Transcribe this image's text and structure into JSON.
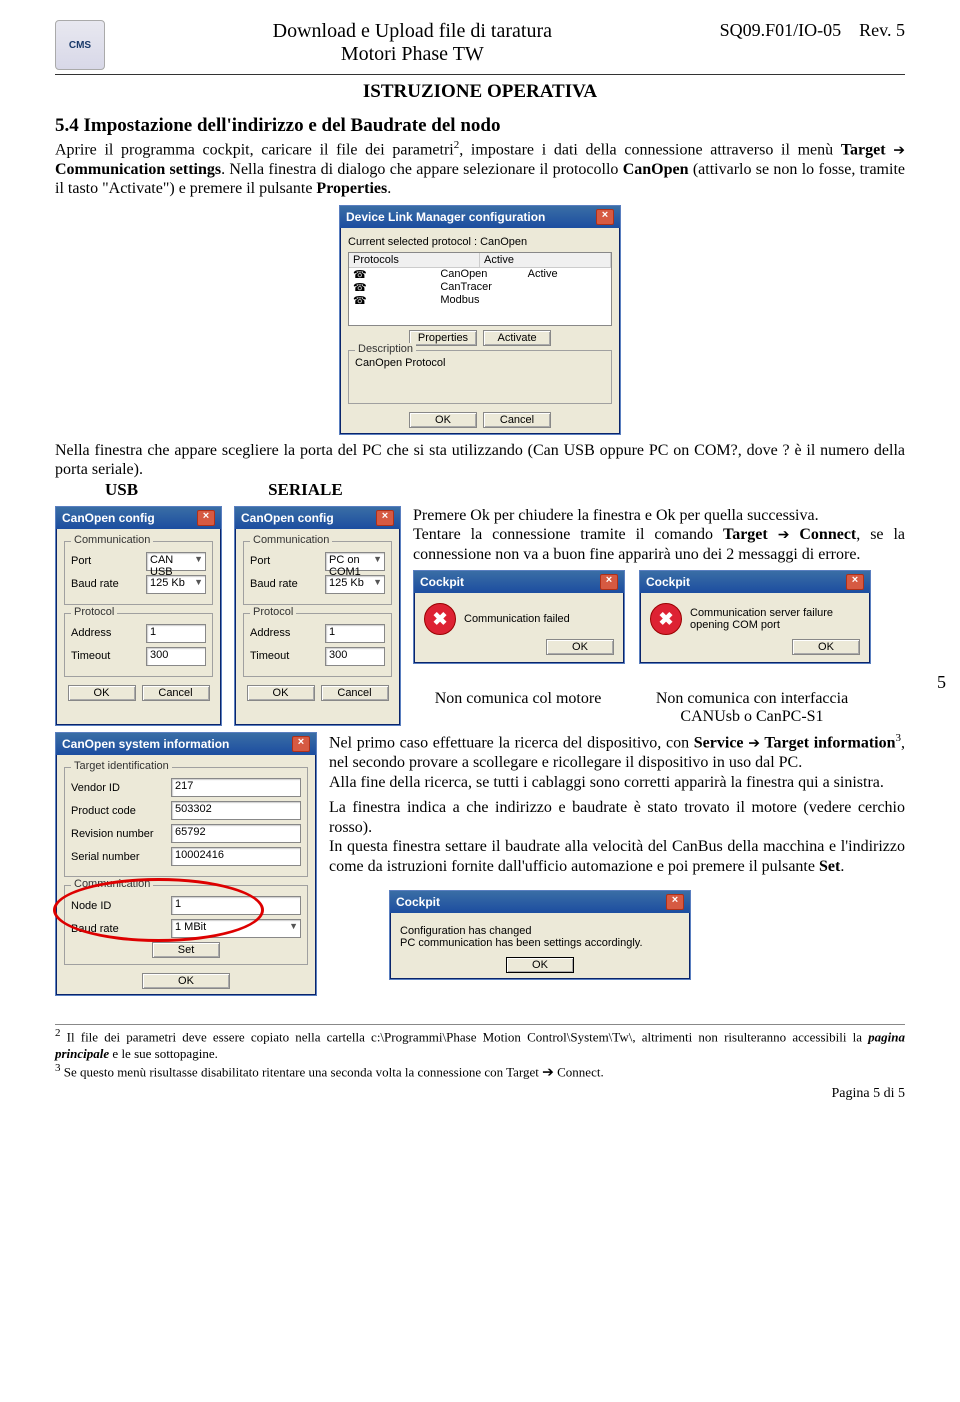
{
  "header": {
    "logo": "CMS",
    "title1": "Download e Upload file di taratura",
    "title2": "Motori Phase TW",
    "code": "SQ09.F01/IO-05",
    "rev": "Rev. 5"
  },
  "doc_title": "ISTRUZIONE OPERATIVA",
  "section_title": "5.4 Impostazione dell'indirizzo e del Baudrate del nodo",
  "para1a": "Aprire il programma cockpit, caricare il file dei parametri",
  "sup2": "2",
  "para1b": ", impostare i dati della connessione attraverso il menù ",
  "para1c": "Target ",
  "para1d": " Communication settings",
  "para1e": ". Nella finestra di dialogo che appare selezionare il protocollo ",
  "para1f": "CanOpen",
  "para1g": " (attivarlo se non lo fosse, tramite il tasto \"Activate\") e premere il pulsante ",
  "para1h": "Properties",
  "para1i": ".",
  "devlink": {
    "title": "Device Link Manager configuration",
    "cur": "Current selected protocol : CanOpen",
    "hdr1": "Protocols",
    "hdr2": "Active",
    "r1": "CanOpen",
    "r1a": "Active",
    "r2": "CanTracer",
    "r3": "Modbus",
    "props": "Properties",
    "activate": "Activate",
    "desc_lbl": "Description",
    "desc": "CanOpen Protocol",
    "ok": "OK",
    "cancel": "Cancel"
  },
  "side_num": "5",
  "para2": "Nella finestra che appare scegliere la porta del PC che si sta utilizzando (Can USB oppure PC on COM?, dove ? è il numero della porta seriale).",
  "colcap1": "USB",
  "colcap2": "SERIALE",
  "canopen": {
    "title": "CanOpen config",
    "comm": "Communication",
    "port": "Port",
    "baud": "Baud rate",
    "port_usb": "CAN USB",
    "port_ser": "PC on COM1",
    "rate": "125 Kb",
    "proto": "Protocol",
    "addr": "Address",
    "addr_v": "1",
    "timeout": "Timeout",
    "timeout_v": "300",
    "ok": "OK",
    "cancel": "Cancel"
  },
  "rtext": {
    "p1": "Premere Ok per chiudere la finestra e Ok per quella successiva.",
    "p2a": "Tentare la connessione tramite il comando ",
    "p2b": "Target ",
    "p2c": " Connect",
    "p2d": ", se la connessione non va a buon fine apparirà uno dei 2 messaggi di errore."
  },
  "cockpit": {
    "title": "Cockpit",
    "fail": "Communication failed",
    "failserver": "Communication server failure opening COM port",
    "ok": "OK"
  },
  "caps": {
    "c1": "Non comunica col motore",
    "c2": "Non comunica con interfaccia CANUsb o CanPC-S1"
  },
  "sysinfo": {
    "title": "CanOpen system information",
    "tgt": "Target identification",
    "vendor": "Vendor ID",
    "vendor_v": "217",
    "prod": "Product code",
    "prod_v": "503302",
    "revn": "Revision number",
    "revn_v": "65792",
    "sn": "Serial number",
    "sn_v": "10002416",
    "comm": "Communication",
    "node": "Node ID",
    "node_v": "1",
    "baud": "Baud rate",
    "baud_v": "1 MBit",
    "set": "Set",
    "ok": "OK"
  },
  "para3": {
    "a": "Nel primo caso effettuare la ricerca del dispositivo, con ",
    "b": "Service ",
    "c": " Target information",
    "sup": "3",
    "d": ", nel secondo provare a scollegare e ricollegare il dispositivo in uso dal PC.",
    "e": "Alla fine della ricerca, se tutti i cablaggi sono corretti apparirà la finestra qui a sinistra.",
    "f": "La finestra indica a che indirizzo e baudrate è stato trovato il motore (vedere cerchio rosso).",
    "g": "In questa finestra settare il baudrate alla velocità del CanBus della macchina e l'indirizzo come da istruzioni fornite dall'ufficio automazione e poi premere il pulsante ",
    "h": "Set",
    "i": "."
  },
  "confchange": {
    "title": "Cockpit",
    "msg": "Configuration has changed\nPC communication has been settings accordingly.",
    "ok": "OK"
  },
  "footnotes": {
    "f2a": "2",
    "f2b": " Il file dei parametri deve essere copiato nella cartella c:\\Programmi\\Phase Motion Control\\System\\Tw\\, altrimenti non risulteranno accessibili la ",
    "f2c": "pagina principale",
    "f2d": " e le sue sottopagine.",
    "f3a": "3",
    "f3b": " Se questo menù risultasse disabilitato ritentare una seconda volta la connessione con Target ",
    "f3c": " Connect."
  },
  "pagenum": "Pagina 5 di 5"
}
